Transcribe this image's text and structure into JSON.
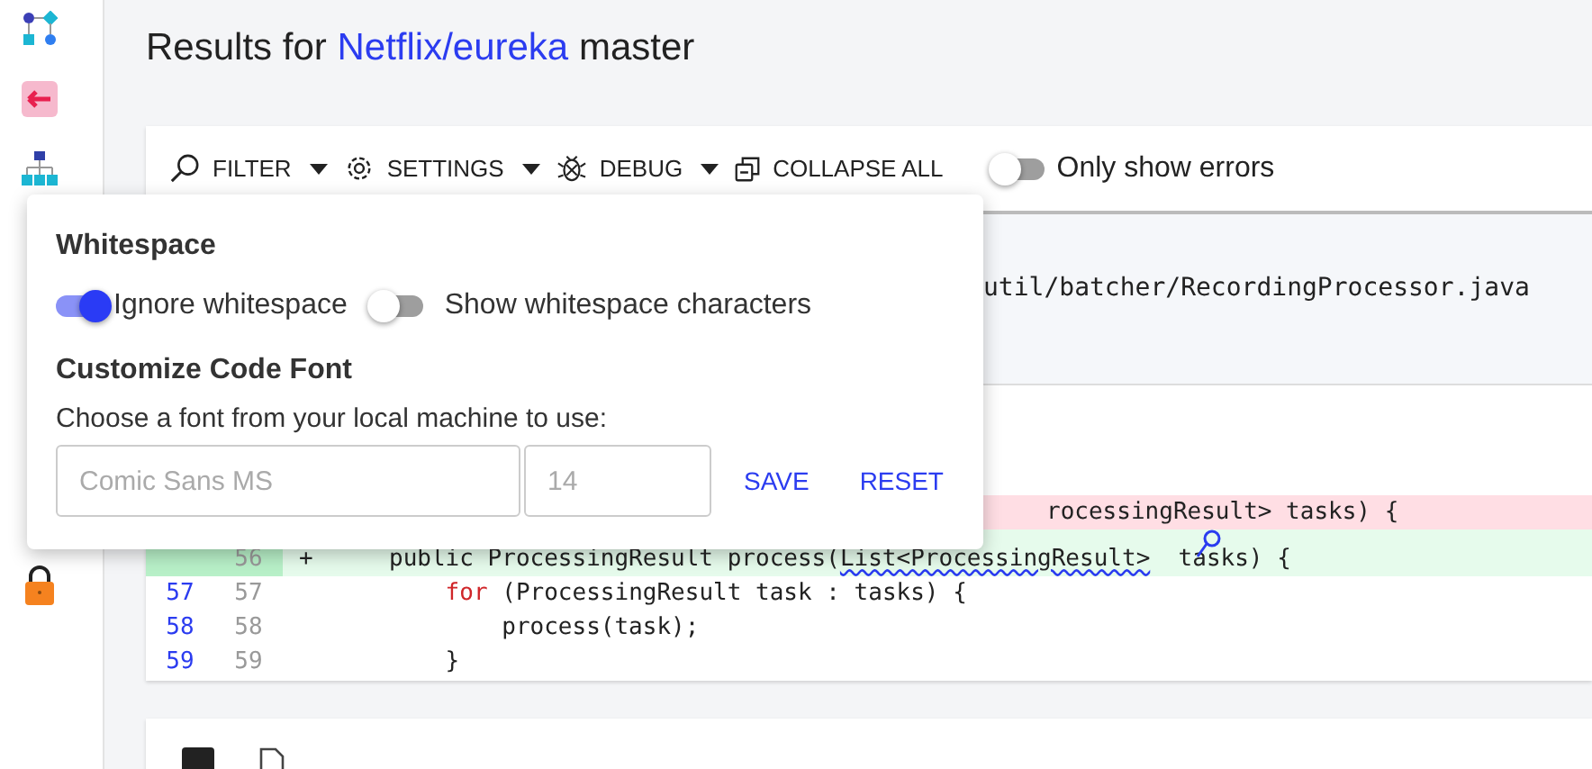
{
  "title": {
    "prefix": "Results for",
    "repo": "Netflix/eureka",
    "branch": "master"
  },
  "toolbar": {
    "menus": [
      {
        "label": "FILTER"
      },
      {
        "label": "SETTINGS"
      },
      {
        "label": "DEBUG"
      }
    ],
    "collapse": "COLLAPSE ALL",
    "errors_toggle": {
      "label": "Only show errors",
      "on": false
    }
  },
  "file": {
    "path": "util/batcher/RecordingProcessor.java"
  },
  "diff": [
    {
      "kind": "del",
      "segments": [
        {
          "kind": "plain",
          "text": "rocessingResult> tasks) {"
        }
      ]
    },
    {
      "kind": "add",
      "new": "56",
      "sign": "+",
      "segments": [
        {
          "kind": "plain",
          "text": "public ProcessingResult process("
        },
        {
          "kind": "squiggle",
          "text": "List<ProcessingResult>"
        },
        {
          "kind": "plain",
          "text": "  tasks) {"
        }
      ]
    },
    {
      "kind": "same",
      "old": "57",
      "new": "57",
      "segments": [
        {
          "kind": "keyword",
          "text": "    for"
        },
        {
          "kind": "plain",
          "text": " (ProcessingResult task : tasks) {"
        }
      ]
    },
    {
      "kind": "same",
      "old": "58",
      "new": "58",
      "segments": [
        {
          "kind": "plain",
          "text": "        process(task);"
        }
      ]
    },
    {
      "kind": "same",
      "old": "59",
      "new": "59",
      "segments": [
        {
          "kind": "plain",
          "text": "    }"
        }
      ]
    }
  ],
  "popover": {
    "title": "Whitespace",
    "toggles": [
      {
        "label": "Ignore whitespace",
        "on": true
      },
      {
        "label": "Show whitespace characters",
        "on": false
      }
    ],
    "font_title": "Customize Code Font",
    "hint": "Choose a font from your local machine to use:",
    "font_field": {
      "placeholder": "Comic Sans MS"
    },
    "size_field": {
      "placeholder": "14"
    },
    "buttons": [
      "SAVE",
      "RESET"
    ]
  }
}
